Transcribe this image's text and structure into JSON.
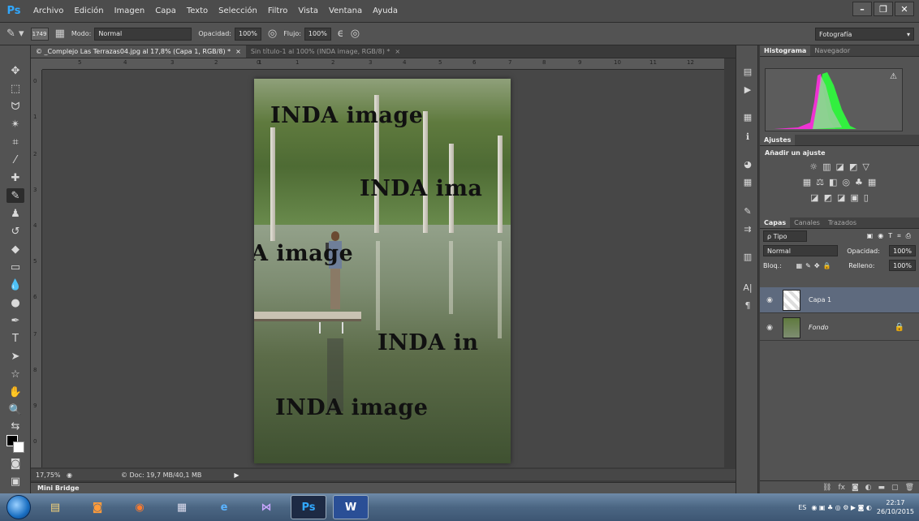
{
  "app": {
    "logo": "Ps",
    "menu": [
      "Archivo",
      "Edición",
      "Imagen",
      "Capa",
      "Texto",
      "Selección",
      "Filtro",
      "Vista",
      "Ventana",
      "Ayuda"
    ],
    "window_controls": [
      "–",
      "❐",
      "✕"
    ]
  },
  "options": {
    "brush_size": "1749",
    "mode_label": "Modo:",
    "mode_value": "Normal",
    "opacity_label": "Opacidad:",
    "opacity_value": "100%",
    "flow_label": "Flujo:",
    "flow_value": "100%",
    "workspace": "Fotografía"
  },
  "tabs": [
    {
      "label": "© _Complejo Las Terrazas04.jpg al 17,8% (Capa 1, RGB/8) *",
      "close": "×"
    },
    {
      "label": "Sin título-1 al 100% (INDA image, RGB/8) *",
      "close": "×"
    }
  ],
  "rulers": {
    "horizontal": [
      "5",
      "4",
      "3",
      "2",
      "1",
      "0",
      "1",
      "2",
      "3",
      "4",
      "5",
      "6",
      "7",
      "8",
      "9",
      "10",
      "11",
      "12"
    ],
    "vertical": [
      "0",
      "1",
      "2",
      "3",
      "4",
      "5",
      "6",
      "7",
      "8",
      "9",
      "0"
    ]
  },
  "document": {
    "watermarks": [
      "INDA image",
      "INDA ima",
      "A image",
      "INDA in",
      "INDA image"
    ]
  },
  "status": {
    "zoom": "17,75%",
    "doc_info": "© Doc: 19,7 MB/40,1 MB",
    "arrow": "▶"
  },
  "mini_bridge": "Mini Bridge",
  "panels": {
    "top_tabs": [
      "Histograma",
      "Navegador"
    ],
    "histogram_warning": "⚠",
    "adjust_tab": "Ajustes",
    "adjust_title": "Añadir un ajuste",
    "layer_tabs": [
      "Capas",
      "Canales",
      "Trazados"
    ],
    "kind_filter": "ρ Tipo",
    "blend_mode": "Normal",
    "opacity_label": "Opacidad:",
    "opacity_value": "100%",
    "lock_label": "Bloq.:",
    "fill_label": "Relleno:",
    "fill_value": "100%",
    "layers": [
      {
        "name": "Capa 1",
        "selected": true
      },
      {
        "name": "Fondo",
        "selected": false
      }
    ]
  },
  "taskbar": {
    "language": "ES",
    "time": "22:17",
    "date": "26/10/2015"
  },
  "colors": {
    "accent": "#31a8ff",
    "panel_bg": "#535353",
    "selection": "#5e6a7e"
  }
}
